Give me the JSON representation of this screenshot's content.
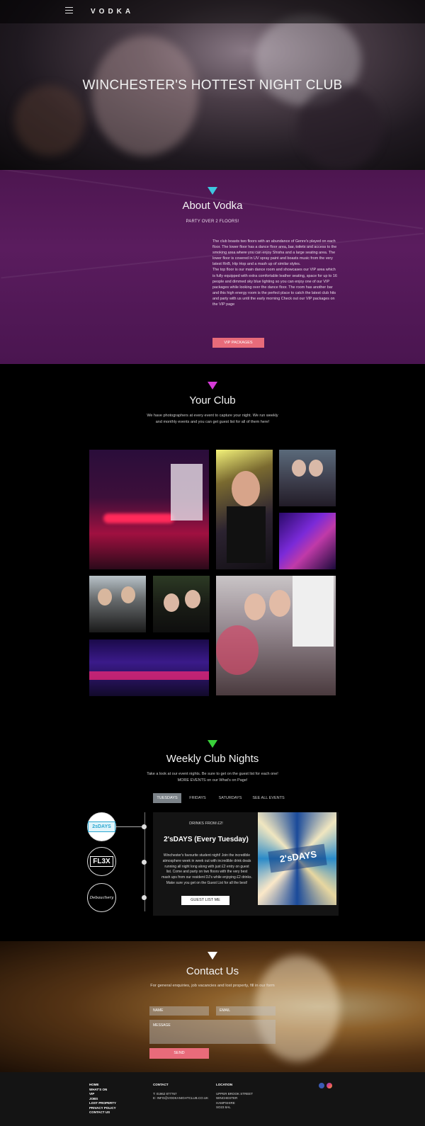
{
  "header": {
    "logo": "VODKA",
    "hero_title": "WINCHESTER'S HOTTEST NIGHT CLUB"
  },
  "about": {
    "title": "About Vodka",
    "subtitle": "PARTY OVER 2 FLOORS!",
    "paragraph1": "The club boasts two floors with an abundance of Genre's played on each floor. The lower floor has a dance floor area, bar, toilets and access to the smoking area where you can enjoy Shisha and a large seating area. The lower floor is covered in UV spray paint and boasts music from the very latest RnB, Hip Hop and a mash up of similar styles.",
    "paragraph2": "The top floor is our main dance room and showcases our VIP area which is fully equipped with extra comfortable leather seating, space for up to 16 people and dimmed sky blue lighting so you can enjoy one of our VIP packages while looking over the dance floor. The room has another bar and this high energy room is the perfect place to catch the latest club hits and party with us until the early morning Check out our VIP packages on the VIP page",
    "button": "VIP PACKAGES"
  },
  "club": {
    "title": "Your Club",
    "description": "We have photographers at every event to capture your night. We run weekly and monthly events and you can get guest list for all of them here!"
  },
  "weekly": {
    "title": "Weekly Club Nights",
    "description": "Take a look at our event nights. Be sure to get on the guest list for each one! MORE EVENTS on our What's on Page!",
    "tabs": [
      "TUESDAYS",
      "FRIDAYS",
      "SATURDAYS",
      "SEE ALL EVENTS"
    ],
    "logos": [
      "2sDAYS",
      "FL3X",
      "Debauchery"
    ],
    "card": {
      "pre_title": "DRINKS FROM £2!",
      "title": "2'sDAYS (Every Tuesday)",
      "text": "Winchester's favourite student night! Join the incredible atmosphere week in week out with incredible drink deals running all night long along with just £2 entry on guest list. Come and party on two floors with the very best mash ups from our resident DJ's while enjoying £2 drinks. Make sure you get on the Guest List for all the best!",
      "button": "GUEST LIST ME",
      "poster_text": "2'sDAYS"
    }
  },
  "contact": {
    "title": "Contact Us",
    "description": "For general enquiries, job vacancies and lost property, fill in our form",
    "name_label": "NAME",
    "email_label": "EMAIL",
    "message_label": "MESSAGE",
    "send": "SEND"
  },
  "footer": {
    "links": [
      "HOME",
      "WHAT'S ON",
      "VIP",
      "JOBS",
      "LOST PROPERTY",
      "PRIVACY POLICY",
      "CONTACT US"
    ],
    "contact_heading": "CONTACT",
    "phone": "T: 01962 877767",
    "email": "E: INFO@VODKANIGHTCLUB.CO.UK",
    "location_heading": "LOCATION",
    "address": [
      "UPPER BROOK STREET",
      "WINCHESTER",
      "HAMPSHIRE",
      "SO23 8AL"
    ]
  },
  "colors": {
    "accent": "#e86b7a",
    "about_bg": "#5a1c5e",
    "chevron_about": "#3ec6e0",
    "chevron_club": "#d63ad8",
    "chevron_weekly": "#39d13a",
    "chevron_contact": "#ffffff"
  },
  "icons": [
    "hamburger-menu-icon",
    "facebook-icon",
    "instagram-icon"
  ]
}
